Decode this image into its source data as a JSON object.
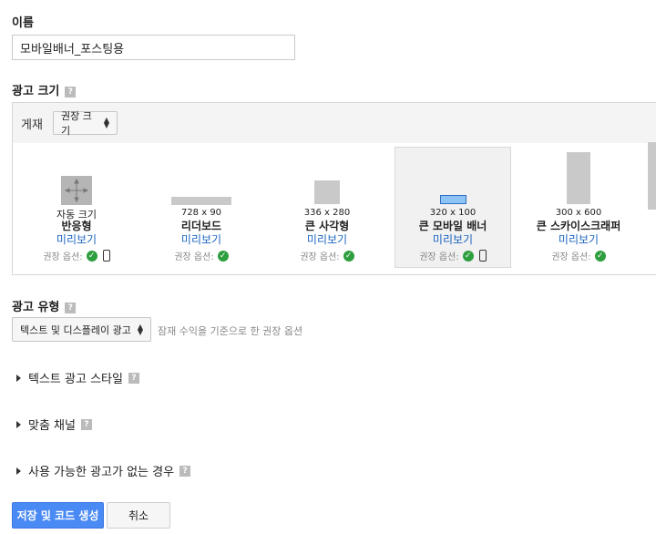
{
  "name_section": {
    "label": "이름",
    "value": "모바일배너_포스팅용"
  },
  "size_section": {
    "label": "광고 크기",
    "posting_label": "게재",
    "select_value": "권장 크기",
    "cards": [
      {
        "dims": "",
        "name_line1": "자동 크기",
        "name": "반응형",
        "preview": "미리보기",
        "rec": "권장 옵션:"
      },
      {
        "dims": "728 x 90",
        "name": "리더보드",
        "preview": "미리보기",
        "rec": "권장 옵션:"
      },
      {
        "dims": "336 x 280",
        "name": "큰 사각형",
        "preview": "미리보기",
        "rec": "권장 옵션:"
      },
      {
        "dims": "320 x 100",
        "name": "큰 모바일 배너",
        "preview": "미리보기",
        "rec": "권장 옵션:"
      },
      {
        "dims": "300 x 600",
        "name": "큰 스카이스크래퍼",
        "preview": "미리보기",
        "rec": "권장 옵션:"
      }
    ]
  },
  "type_section": {
    "label": "광고 유형",
    "select_value": "텍스트 및 디스플레이 광고",
    "hint": "잠재 수익을 기준으로 한 권장 옵션"
  },
  "collapsibles": [
    {
      "label": "텍스트 광고 스타일"
    },
    {
      "label": "맞춤 채널"
    },
    {
      "label": "사용 가능한 광고가 없는 경우"
    }
  ],
  "buttons": {
    "save": "저장 및 코드 생성",
    "cancel": "취소"
  },
  "icons": {
    "help": "?",
    "check": "✓"
  },
  "colors": {
    "primary": "#4a8af4",
    "link": "#1a64c0",
    "check": "#2e9e3e",
    "selected_thumb": "#8ec4f5"
  }
}
